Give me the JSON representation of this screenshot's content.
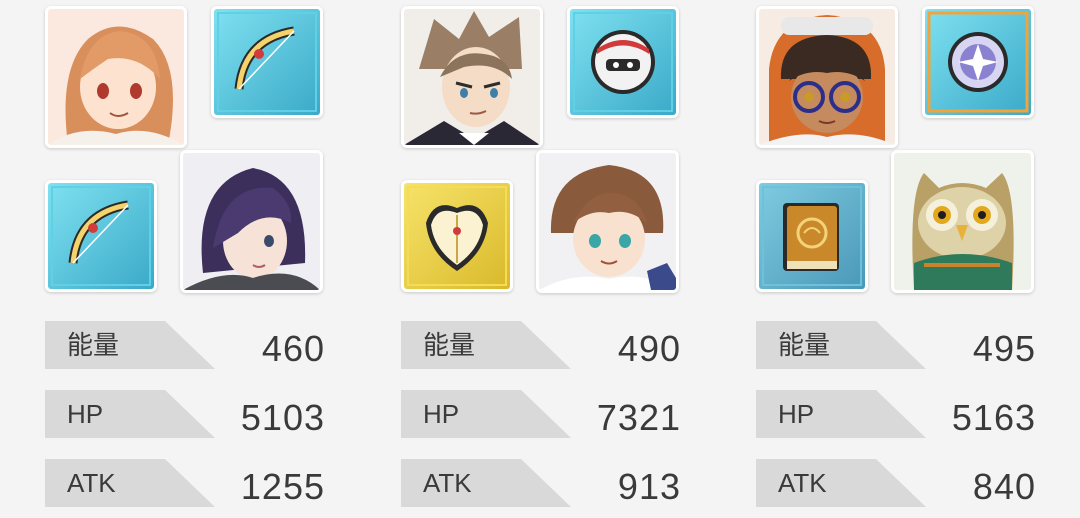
{
  "teams": [
    {
      "leader": {
        "icon": "orange-haired-girl-portrait-icon"
      },
      "leader_weapon": {
        "icon": "golden-bow-icon"
      },
      "member": {
        "icon": "purple-haired-boy-portrait-icon"
      },
      "member_weapon": {
        "icon": "golden-bow-icon"
      },
      "stats": [
        {
          "label": "能量",
          "value": "460"
        },
        {
          "label": "HP",
          "value": "5103"
        },
        {
          "label": "ATK",
          "value": "1255"
        }
      ]
    },
    {
      "leader": {
        "icon": "brown-haired-man-portrait-icon"
      },
      "leader_weapon": {
        "icon": "robot-orb-icon"
      },
      "member": {
        "icon": "brown-haired-boy-portrait-icon"
      },
      "member_weapon": {
        "icon": "winged-shield-icon"
      },
      "stats": [
        {
          "label": "能量",
          "value": "490"
        },
        {
          "label": "HP",
          "value": "7321"
        },
        {
          "label": "ATK",
          "value": "913"
        }
      ]
    },
    {
      "leader": {
        "icon": "girl-with-goggles-portrait-icon"
      },
      "leader_weapon": {
        "icon": "crystal-orb-icon"
      },
      "member": {
        "icon": "owl-portrait-icon"
      },
      "member_weapon": {
        "icon": "spell-book-icon"
      },
      "stats": [
        {
          "label": "能量",
          "value": "495"
        },
        {
          "label": "HP",
          "value": "5163"
        },
        {
          "label": "ATK",
          "value": "840"
        }
      ]
    }
  ]
}
